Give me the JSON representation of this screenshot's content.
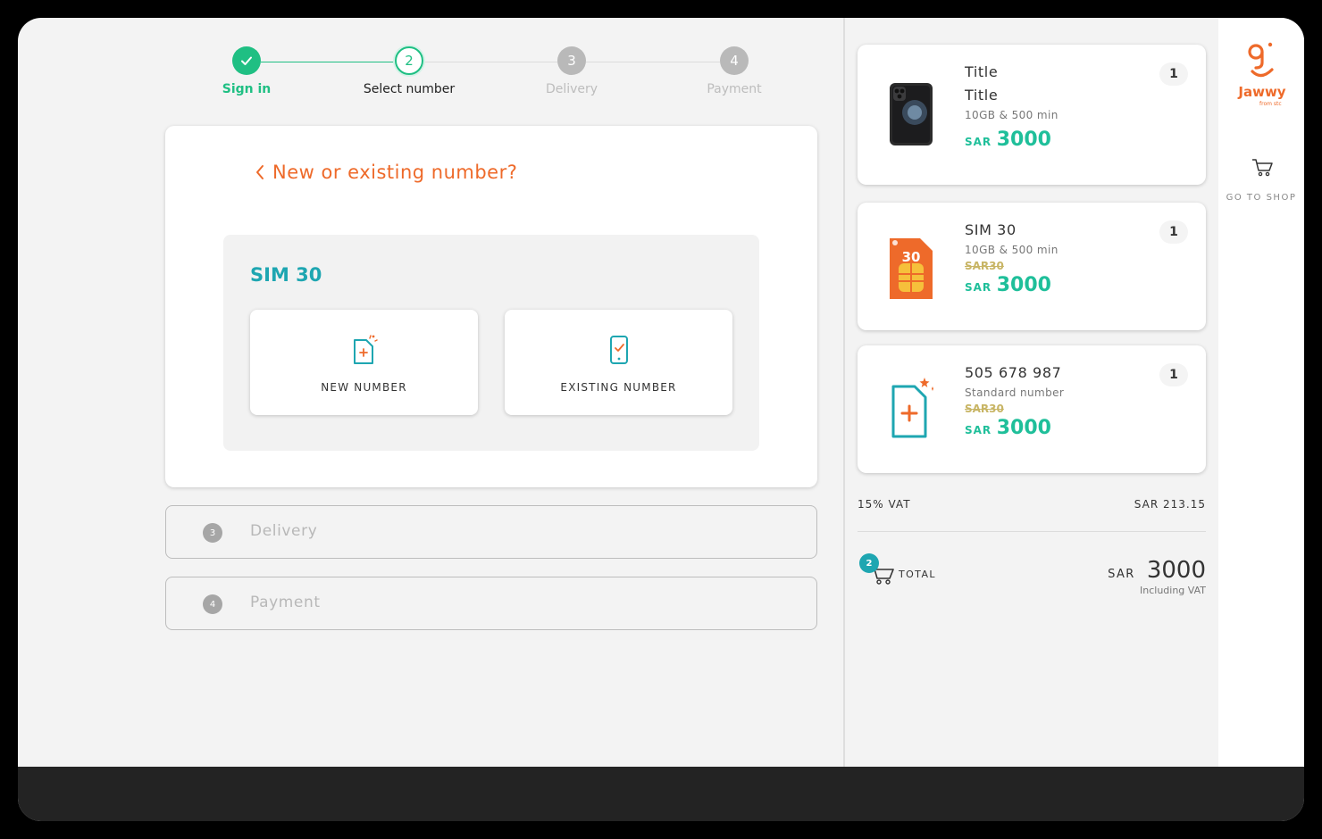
{
  "stepper": {
    "steps": [
      {
        "num": "1",
        "label": "Sign in",
        "state": "done"
      },
      {
        "num": "2",
        "label": "Select number",
        "state": "active"
      },
      {
        "num": "3",
        "label": "Delivery",
        "state": "pending"
      },
      {
        "num": "4",
        "label": "Payment",
        "state": "pending"
      }
    ]
  },
  "main": {
    "title": "New or existing number?",
    "sim_name": "SIM 30",
    "options": {
      "new_label": "NEW NUMBER",
      "existing_label": "EXISTING NUMBER"
    }
  },
  "collapsed_steps": [
    {
      "num": "3",
      "label": "Delivery"
    },
    {
      "num": "4",
      "label": "Payment"
    }
  ],
  "cart": {
    "items": [
      {
        "line1": "Title",
        "line2": "Title",
        "sub": "10GB & 500 min",
        "old_price": "",
        "currency": "SAR",
        "price": "3000",
        "qty": "1"
      },
      {
        "line1": "SIM 30",
        "sub": "10GB & 500 min",
        "old_price": "SAR30",
        "currency": "SAR",
        "price": "3000",
        "qty": "1",
        "sim_badge": "30"
      },
      {
        "line1": "505 678 987",
        "sub": "Standard number",
        "old_price": "SAR30",
        "currency": "SAR",
        "price": "3000",
        "qty": "1"
      }
    ],
    "vat_label": "15% VAT",
    "vat_value": "SAR 213.15",
    "total_label": "TOTAL",
    "total_badge": "2",
    "total_currency": "SAR",
    "total_amount": "3000",
    "total_note": "Including VAT"
  },
  "rail": {
    "logo_text": "Jawwy",
    "logo_sub": "from stc",
    "shop_label": "GO TO SHOP"
  },
  "colors": {
    "accent_green": "#1fbf83",
    "accent_orange": "#ee6a2a",
    "accent_teal": "#1ea6b1",
    "price_green": "#1fbf9a"
  }
}
